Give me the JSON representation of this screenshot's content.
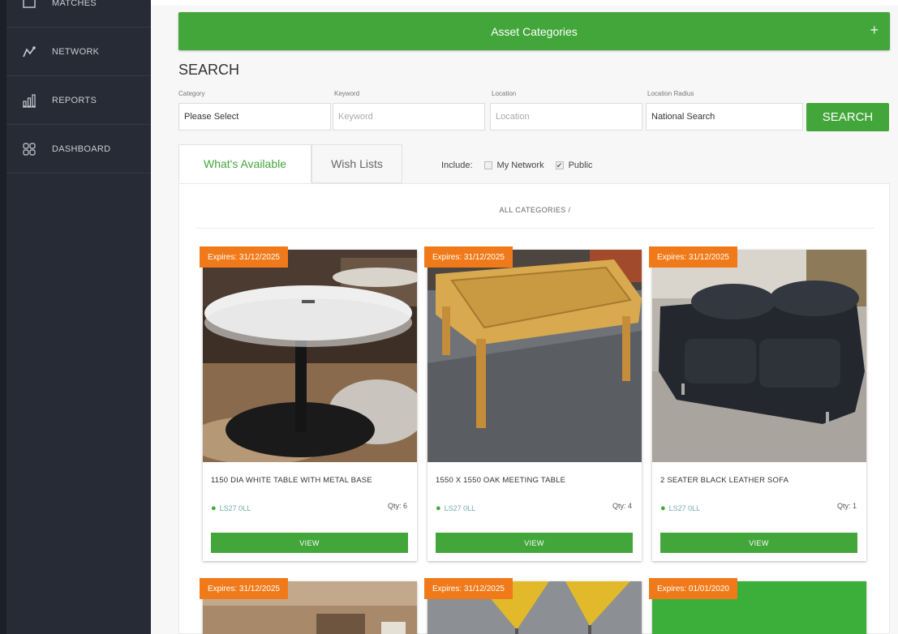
{
  "sidebar": {
    "items": [
      {
        "label": "MATCHES",
        "icon": "matches-icon"
      },
      {
        "label": "NETWORK",
        "icon": "network-icon"
      },
      {
        "label": "REPORTS",
        "icon": "reports-icon"
      },
      {
        "label": "DASHBOARD",
        "icon": "dashboard-icon"
      }
    ]
  },
  "asset_categories": {
    "label": "Asset Categories",
    "plus": "+"
  },
  "search": {
    "title": "SEARCH",
    "category": {
      "label": "Category",
      "value": "Please Select"
    },
    "keyword": {
      "label": "Keyword",
      "placeholder": "Keyword"
    },
    "location": {
      "label": "Location",
      "placeholder": "Location"
    },
    "radius": {
      "label": "Location Radius",
      "value": "National Search"
    },
    "button": "SEARCH"
  },
  "tabs": [
    {
      "label": "What's Available",
      "active": true
    },
    {
      "label": "Wish Lists",
      "active": false
    }
  ],
  "include": {
    "label": "Include:",
    "options": [
      {
        "label": "My Network",
        "checked": false
      },
      {
        "label": "Public",
        "checked": true
      }
    ]
  },
  "breadcrumb": "ALL CATEGORIES /",
  "cards": [
    {
      "badge": "Expires: 31/12/2025",
      "title": "1150 DIA WHITE TABLE WITH METAL BASE",
      "location": "LS27 0LL",
      "qty": "Qty: 6",
      "button": "VIEW"
    },
    {
      "badge": "Expires: 31/12/2025",
      "title": "1550 X 1550 OAK MEETING TABLE",
      "location": "LS27 0LL",
      "qty": "Qty: 4",
      "button": "VIEW"
    },
    {
      "badge": "Expires: 31/12/2025",
      "title": "2 SEATER BLACK LEATHER SOFA",
      "location": "LS27 0LL",
      "qty": "Qty: 1",
      "button": "VIEW"
    },
    {
      "badge": "Expires: 31/12/2025"
    },
    {
      "badge": "Expires: 31/12/2025"
    },
    {
      "badge": "Expires: 01/01/2020"
    }
  ],
  "colors": {
    "accent": "#43a63b",
    "badge": "#f07a1a",
    "sidebar": "#272b35"
  }
}
